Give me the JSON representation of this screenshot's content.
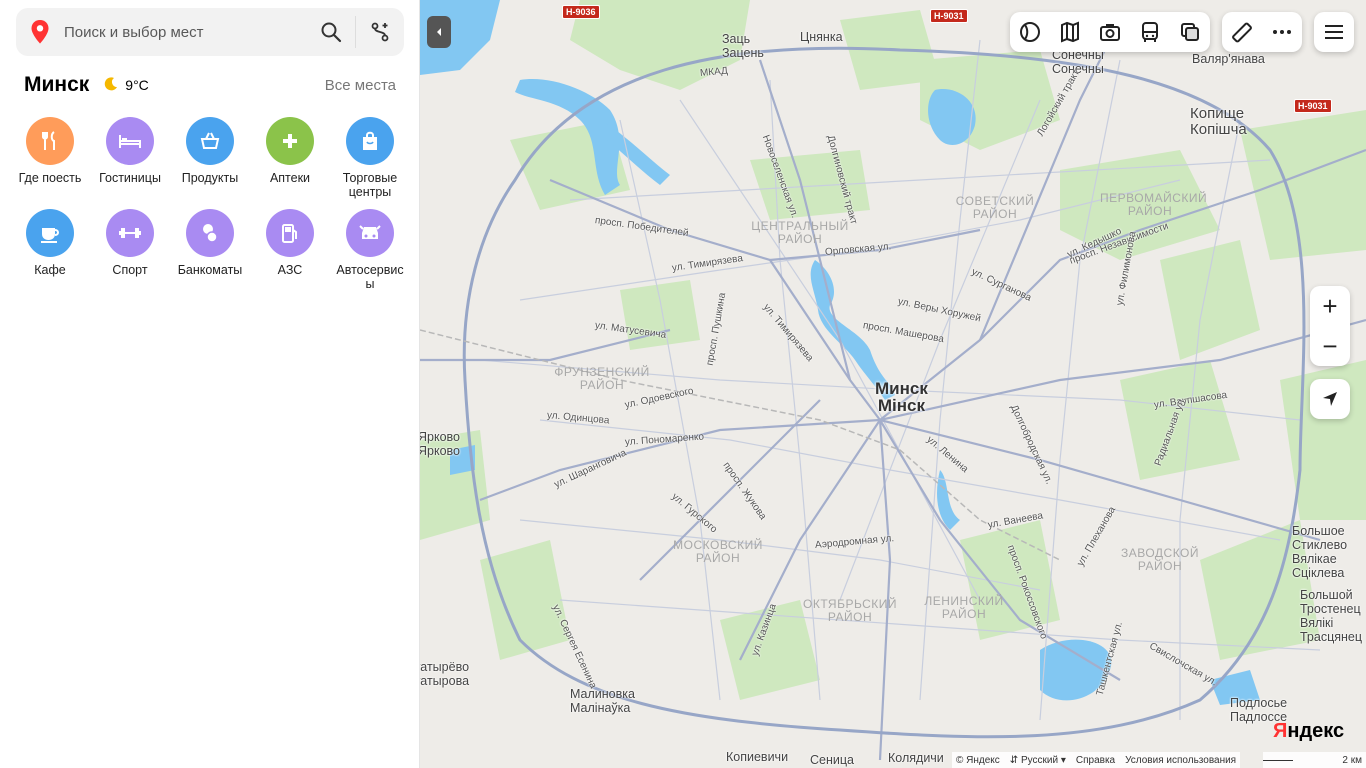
{
  "search": {
    "placeholder": "Поиск и выбор мест"
  },
  "city": {
    "name": "Минск",
    "temperature": "9°C",
    "all_places": "Все места"
  },
  "categories": [
    {
      "label": "Где поесть",
      "color": "#ff9c5a",
      "icon": "fork-knife-icon"
    },
    {
      "label": "Гостиницы",
      "color": "#a98bf2",
      "icon": "bed-icon"
    },
    {
      "label": "Продукты",
      "color": "#4aa3ee",
      "icon": "basket-icon"
    },
    {
      "label": "Аптеки",
      "color": "#8bc34a",
      "icon": "plus-icon"
    },
    {
      "label": "Торговые центры",
      "color": "#4aa3ee",
      "icon": "shopping-bag-icon"
    },
    {
      "label": "Кафе",
      "color": "#4aa3ee",
      "icon": "coffee-cup-icon"
    },
    {
      "label": "Спорт",
      "color": "#a98bf2",
      "icon": "dumbbell-icon"
    },
    {
      "label": "Банкоматы",
      "color": "#a98bf2",
      "icon": "coins-icon"
    },
    {
      "label": "АЗС",
      "color": "#a98bf2",
      "icon": "fuel-icon"
    },
    {
      "label": "Автосервисы",
      "color": "#a98bf2",
      "icon": "car-icon"
    }
  ],
  "map": {
    "city_label": "Минск",
    "city_label_by": "Мінск",
    "towns": [
      {
        "text": "Заць",
        "text2": "Зацень"
      },
      {
        "text": "Цнянка"
      },
      {
        "text": "Сонечны",
        "text2": "Сонечны"
      },
      {
        "text": "Валяр'янава"
      },
      {
        "text": "Копище",
        "text2": "Копішча"
      },
      {
        "text": "Ярково",
        "text2": "Ярково"
      },
      {
        "text": "Большое Стиклево",
        "text2": "Вялікае Сціклева"
      },
      {
        "text": "Большой Тростенец",
        "text2": "Вялікі Трасцянец"
      },
      {
        "text": "гатырёво",
        "text2": "гатырова"
      },
      {
        "text": "Малиновка",
        "text2": "Малінаўка"
      },
      {
        "text": "Подлосье",
        "text2": "Падлоссе"
      },
      {
        "text": "Копиевичи"
      },
      {
        "text": "Сеница"
      },
      {
        "text": "Колядичи"
      }
    ],
    "districts": [
      "ЦЕНТРАЛЬНЫЙ РАЙОН",
      "СОВЕТСКИЙ РАЙОН",
      "ПЕРВОМАЙСКИЙ РАЙОН",
      "ФРУНЗЕНСКИЙ РАЙОН",
      "МОСКОВСКИЙ РАЙОН",
      "ОКТЯБРЬСКИЙ РАЙОН",
      "ЛЕНИНСКИЙ РАЙОН",
      "ЗАВОДСКОЙ РАЙОН"
    ],
    "streets": [
      "МКАД",
      "просп. Победителей",
      "ул. Тимирязева",
      "Орловская ул.",
      "ул. Сурганова",
      "просп. Независимости",
      "ул. Веры Хоружей",
      "просп. Машерова",
      "ул. Матусевича",
      "просп. Пушкина",
      "ул. Одинцова",
      "ул. Одоевского",
      "ул. Пономаренко",
      "ул. Шаранговича",
      "ул. Гурского",
      "просп. Жукова",
      "Аэродромная ул.",
      "ул. Ленина",
      "Долгобродская ул.",
      "ул. Ваупшасова",
      "ул. Ванеева",
      "просп. Рокоссовского",
      "ул. Плеханова",
      "Радиальная ул.",
      "ул. Казинца",
      "ул. Сергея Есенина",
      "Ташкентская ул.",
      "Свислочская ул.",
      "Долгиновский тракт",
      "Логойский тракт",
      "ул. Филимонова",
      "ул. Кедышко",
      "Новоселенская ул.",
      "ул. Тимирязева"
    ],
    "highways": [
      "Н-9036",
      "Н-9031",
      "Н-9031"
    ],
    "zoom_in": "+",
    "zoom_out": "−",
    "copyright": "© Яндекс",
    "language": "Русский",
    "help": "Справка",
    "terms": "Условия использования",
    "brand_y": "Я",
    "brand_rest": "ндекс",
    "scale": "2 км"
  },
  "colors": {
    "map_bg": "#eeece8",
    "water": "#7fc4f0",
    "park": "#c8e6b8",
    "road": "#a9b3cf",
    "ring_road": "#9aa8c8",
    "accent_red": "#f33"
  }
}
